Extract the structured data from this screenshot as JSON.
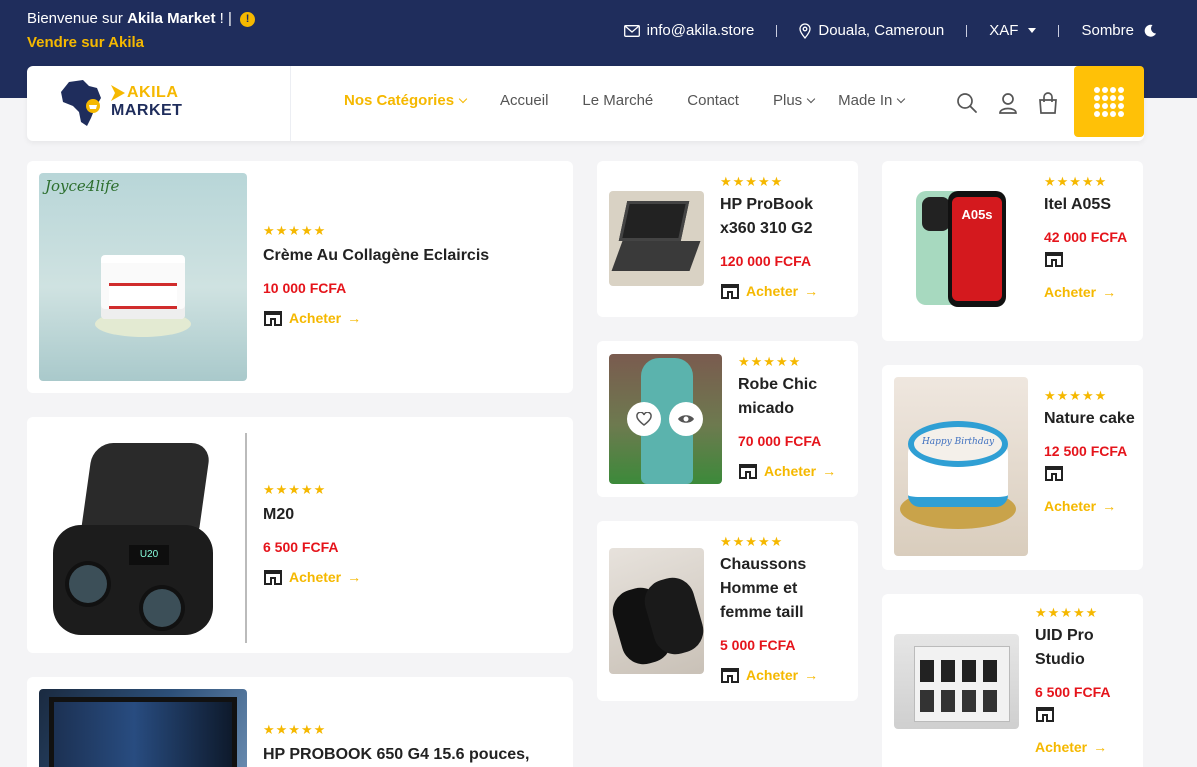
{
  "topbar": {
    "welcome_prefix": "Bienvenue sur ",
    "brand": "Akila Market",
    "welcome_suffix": " ! |",
    "info_glyph": "!",
    "sell_link": "Vendre sur Akila",
    "email": "info@akila.store",
    "location": "Douala, Cameroun",
    "currency": "XAF",
    "theme_label": "Sombre"
  },
  "header": {
    "logo_line1": "AKILA",
    "logo_line2": "MARKET",
    "nav": [
      {
        "label": "Nos Catégories",
        "active": true,
        "has_dropdown": true
      },
      {
        "label": "Accueil",
        "active": false,
        "has_dropdown": false
      },
      {
        "label": "Le Marché",
        "active": false,
        "has_dropdown": false
      },
      {
        "label": "Contact",
        "active": false,
        "has_dropdown": false
      },
      {
        "label": "Plus",
        "active": false,
        "has_dropdown": true
      },
      {
        "label": "Made In",
        "active": false,
        "has_dropdown": true
      }
    ],
    "icons": [
      "search-icon",
      "user-icon",
      "cart-icon",
      "apps-grid-icon"
    ]
  },
  "products": [
    {
      "name": "Crème Au Collagène Eclaircis",
      "price": "10 000 FCFA",
      "rating": "★★★★★",
      "buy": "Acheter",
      "image_label": "Joyce4life"
    },
    {
      "name": "M20",
      "price": "6 500 FCFA",
      "rating": "★★★★★",
      "buy": "Acheter",
      "image_label": "U20"
    },
    {
      "name": "HP PROBOOK 650 G4 15.6 pouces,",
      "price": "",
      "rating": "★★★★★",
      "buy": "Acheter"
    },
    {
      "name": "HP ProBook x360 310 G2",
      "price": "120 000 FCFA",
      "rating": "★★★★★",
      "buy": "Acheter"
    },
    {
      "name": "Robe Chic micado",
      "price": "70 000 FCFA",
      "rating": "★★★★★",
      "buy": "Acheter"
    },
    {
      "name": "Chaussons Homme et femme taill",
      "price": "5 000 FCFA",
      "rating": "★★★★★",
      "buy": "Acheter"
    },
    {
      "name": "Itel A05S",
      "price": "42 000 FCFA",
      "rating": "★★★★★",
      "buy": "Acheter",
      "image_label": "A05s"
    },
    {
      "name": "Nature cake",
      "price": "12 500 FCFA",
      "rating": "★★★★★",
      "buy": "Acheter",
      "image_label": "Happy Birthday"
    },
    {
      "name": "UID Pro Studio",
      "price": "6 500 FCFA",
      "rating": "★★★★★",
      "buy": "Acheter"
    }
  ],
  "colors": {
    "navy": "#1f2d5c",
    "accent": "#f5b800",
    "price": "#e5141b"
  }
}
